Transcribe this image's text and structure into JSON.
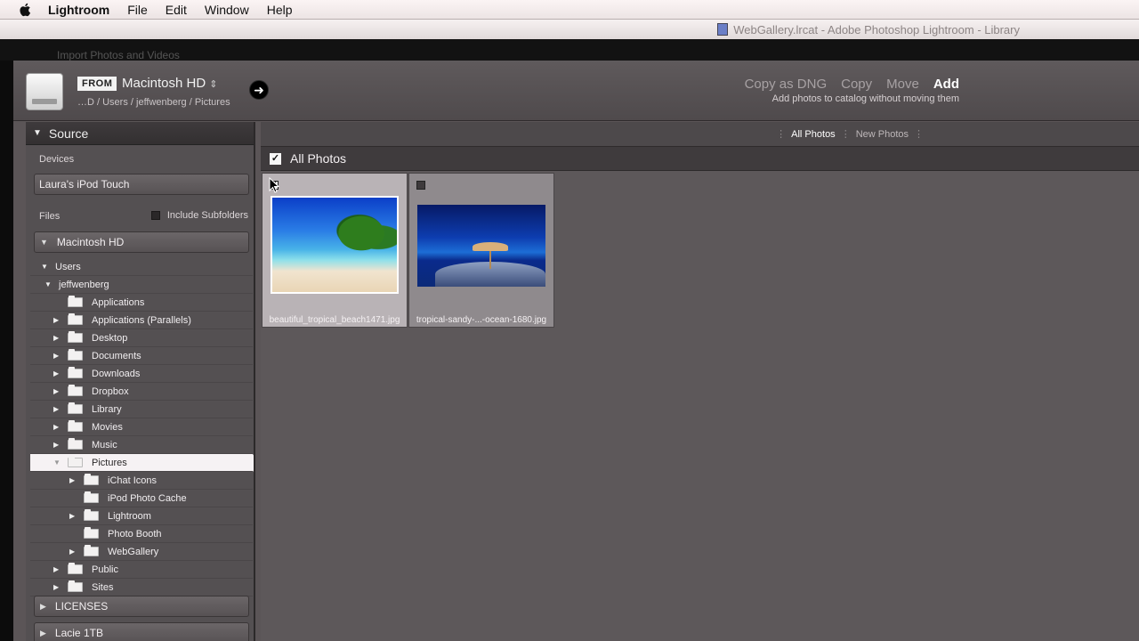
{
  "menubar": {
    "app_name": "Lightroom",
    "items": [
      "File",
      "Edit",
      "Window",
      "Help"
    ]
  },
  "lr_window": {
    "title": "WebGallery.lrcat - Adobe Photoshop Lightroom - Library"
  },
  "dialog": {
    "title": "Import Photos and Videos"
  },
  "from": {
    "badge": "FROM",
    "source": "Macintosh HD",
    "path": "…D / Users / jeffwenberg / Pictures"
  },
  "import_modes": {
    "copy_as_dng": "Copy as DNG",
    "copy": "Copy",
    "move": "Move",
    "add": "Add",
    "description": "Add photos to catalog without moving them"
  },
  "source_panel": {
    "title": "Source",
    "devices_label": "Devices",
    "device": "Laura's iPod Touch",
    "files_label": "Files",
    "include_subfolders": "Include Subfolders",
    "volume": "Macintosh HD",
    "tree": [
      {
        "label": "Users",
        "level": 0,
        "tri": "▼",
        "folder": false
      },
      {
        "label": "jeffwenberg",
        "level": 1,
        "tri": "▼",
        "folder": false
      },
      {
        "label": "Applications",
        "level": 2,
        "tri": "",
        "folder": true
      },
      {
        "label": "Applications (Parallels)",
        "level": 2,
        "tri": "▶",
        "folder": true
      },
      {
        "label": "Desktop",
        "level": 2,
        "tri": "▶",
        "folder": true
      },
      {
        "label": "Documents",
        "level": 2,
        "tri": "▶",
        "folder": true
      },
      {
        "label": "Downloads",
        "level": 2,
        "tri": "▶",
        "folder": true
      },
      {
        "label": "Dropbox",
        "level": 2,
        "tri": "▶",
        "folder": true
      },
      {
        "label": "Library",
        "level": 2,
        "tri": "▶",
        "folder": true
      },
      {
        "label": "Movies",
        "level": 2,
        "tri": "▶",
        "folder": true
      },
      {
        "label": "Music",
        "level": 2,
        "tri": "▶",
        "folder": true
      },
      {
        "label": "Pictures",
        "level": 2,
        "tri": "▼",
        "folder": true,
        "selected": true
      },
      {
        "label": "iChat Icons",
        "level": 3,
        "tri": "▶",
        "folder": true
      },
      {
        "label": "iPod Photo Cache",
        "level": 3,
        "tri": "",
        "folder": true
      },
      {
        "label": "Lightroom",
        "level": 3,
        "tri": "▶",
        "folder": true
      },
      {
        "label": "Photo Booth",
        "level": 3,
        "tri": "",
        "folder": true
      },
      {
        "label": "WebGallery",
        "level": 3,
        "tri": "▶",
        "folder": true
      },
      {
        "label": "Public",
        "level": 2,
        "tri": "▶",
        "folder": true
      },
      {
        "label": "Sites",
        "level": 2,
        "tri": "▶",
        "folder": true
      }
    ],
    "other_volumes": [
      "LICENSES",
      "Lacie 1TB"
    ]
  },
  "grid": {
    "filter_all": "All Photos",
    "filter_new": "New Photos",
    "header_label": "All Photos",
    "photos": [
      {
        "filename": "beautiful_tropical_beach1471.jpg",
        "checked": true
      },
      {
        "filename": "tropical-sandy-...-ocean-1680.jpg",
        "checked": false
      }
    ]
  }
}
